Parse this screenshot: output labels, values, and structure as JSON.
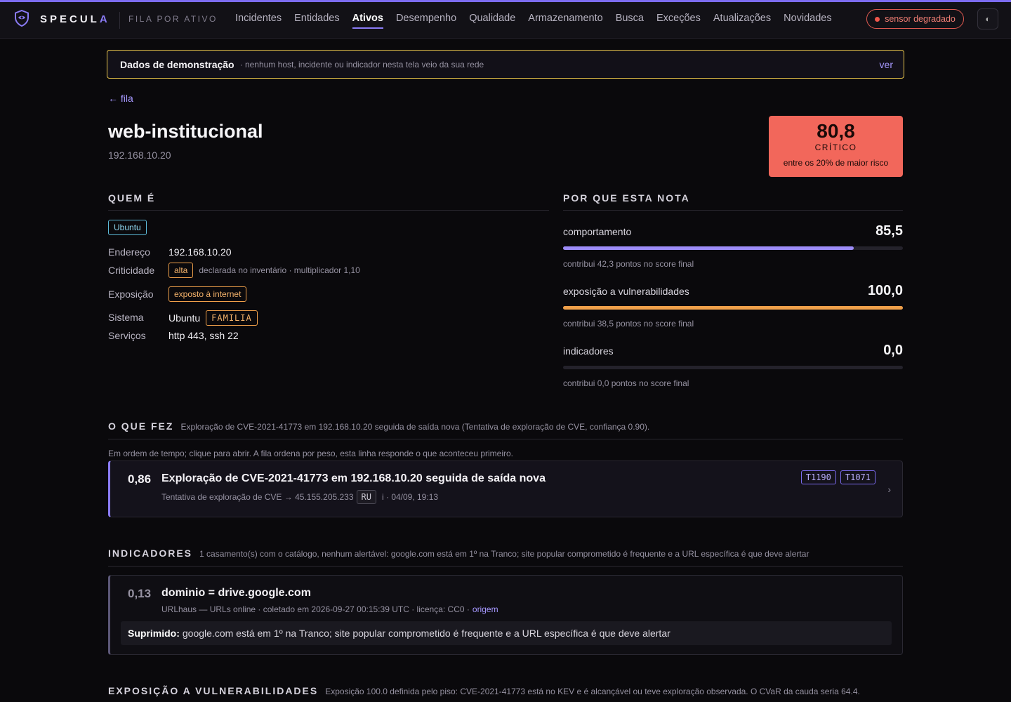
{
  "header": {
    "brand_main": "SPECUL",
    "brand_accent": "A",
    "context": "FILA POR ATIVO",
    "nav": [
      "Incidentes",
      "Entidades",
      "Ativos",
      "Desempenho",
      "Qualidade",
      "Armazenamento",
      "Busca",
      "Exceções",
      "Atualizações",
      "Novidades"
    ],
    "active_nav": "Ativos",
    "sensor_status": "sensor degradado",
    "theme_icon": "◐"
  },
  "banner": {
    "title": "Dados de demonstração",
    "note": "· nenhum host, incidente ou indicador nesta tela veio da sua rede",
    "link": "ver"
  },
  "back_link": "← fila",
  "host": {
    "name": "web-institucional",
    "ip": "192.168.10.20"
  },
  "score": {
    "value": "80,8",
    "level": "CRÍTICO",
    "note": "entre os 20% de maior risco",
    "color": "#f2675b"
  },
  "who": {
    "heading": "QUEM É",
    "os_tag": "Ubuntu",
    "rows": {
      "address_label": "Endereço",
      "address_value": "192.168.10.20",
      "criticality_label": "Criticidade",
      "criticality_tag": "alta",
      "criticality_note": "declarada no inventário · multiplicador 1,10",
      "exposure_label": "Exposição",
      "exposure_tag": "exposto à internet",
      "system_label": "Sistema",
      "system_value": "Ubuntu",
      "system_tag": "FAMILIA",
      "services_label": "Serviços",
      "services_value": "http 443, ssh 22"
    }
  },
  "why": {
    "heading": "POR QUE ESTA NOTA",
    "factors": [
      {
        "name": "comportamento",
        "value": "85,5",
        "fraction": 0.855,
        "color": "#9d8cf8",
        "contrib": "contribui 42,3 pontos no score final"
      },
      {
        "name": "exposição a vulnerabilidades",
        "value": "100,0",
        "fraction": 1.0,
        "color": "#f0a04a",
        "contrib": "contribui 38,5 pontos no score final"
      },
      {
        "name": "indicadores",
        "value": "0,0",
        "fraction": 0.0,
        "color": "#6c6878",
        "contrib": "contribui 0,0 pontos no score final"
      }
    ]
  },
  "did": {
    "heading": "O QUE FEZ",
    "summary": "Exploração de CVE-2021-41773 em 192.168.10.20 seguida de saída nova (Tentativa de exploração de CVE, confiança 0.90).",
    "timeline_note": "Em ordem de tempo; clique para abrir. A fila ordena por peso, esta linha responde o que aconteceu primeiro.",
    "incident": {
      "weight": "0,86",
      "title": "Exploração de CVE-2021-41773 em 192.168.10.20 seguida de saída nova",
      "sub_left": "Tentativa de exploração de CVE → 45.155.205.233",
      "country": "RU",
      "sub_right": "i · 04/09, 19:13",
      "techniques": [
        "T1190",
        "T1071"
      ],
      "chevron": "›"
    }
  },
  "indicators": {
    "heading": "INDICADORES",
    "summary": "1 casamento(s) com o catálogo, nenhum alertável: google.com está em 1º na Tranco; site popular comprometido é frequente e a URL específica é que deve alertar",
    "item": {
      "weight": "0,13",
      "title": "dominio = drive.google.com",
      "source": "URLhaus — URLs online · coletado em 2026-09-27 00:15:39 UTC · licença: CC0 ·",
      "origin_link": "origem",
      "suppressed_label": "Suprimido:",
      "suppressed_text": "google.com está em 1º na Tranco; site popular comprometido é frequente e a URL específica é que deve alertar"
    }
  },
  "vuln": {
    "heading": "EXPOSIÇÃO A VULNERABILIDADES",
    "summary": "Exposição 100.0 definida pelo piso: CVE-2021-41773 está no KEV e é alcançável ou teve exploração observada. O CVaR da cauda seria 64.4."
  }
}
